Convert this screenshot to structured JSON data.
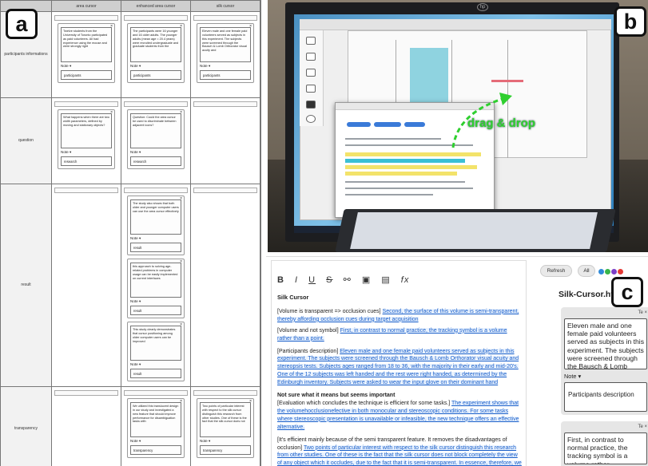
{
  "labels": {
    "a": "a",
    "b": "b",
    "c": "c"
  },
  "panel_a": {
    "columns": [
      "area cursor",
      "enhanced area cursor",
      "silk cursor"
    ],
    "rows": [
      "participants informations",
      "question",
      "result",
      "transparency"
    ],
    "note_label": "Note ▾",
    "close": "×",
    "cards": {
      "r0c0": {
        "text": "Twelve students from the University of Toronto participated as paid volunteers. All had experience using the mouse and were strongly right",
        "note": "participants"
      },
      "r0c1": {
        "text": "The participants were 16 younger and 16 older adults. The younger adults (mean age = 20.4 years) were recruited undergraduate and graduate students from the",
        "note": "participants"
      },
      "r0c2": {
        "text": "Eleven male and one female paid volunteers served as subjects in this experiment. The subjects were screened through the Bausch & Lomb Orthorator visual acuity and",
        "note": "participants"
      },
      "r1c0": {
        "text": "What happens when there are two width parameters, defined by moving and stationary objects?",
        "note": "research"
      },
      "r1c1": {
        "text": "Question: Could the area cursor be used to discriminate between adjacent icons?",
        "note": "research"
      },
      "r2c1a": {
        "text": "The study also shows that both older and younger computer users can use the area cursor effectively",
        "note": "result"
      },
      "r2c1b": {
        "text": "this approach to solving age- related problems in computer usage can be easily implemented on current interfaces",
        "note": "result"
      },
      "r2c1c": {
        "text": "This study clearly demonstrates that cursor positioning among older computer users can be improved",
        "note": "result"
      },
      "r3c1": {
        "text": "We utilized this translucent design in our study and investigated a new feature that should improve performance for disambiguation tasks with",
        "note": "transparency"
      },
      "r3c2": {
        "text": "Two points of particular interest with respect to the silk cursor distinguish this research from other studies. One of these is the fact that the silk cursor does not",
        "note": "transparency"
      }
    }
  },
  "panel_b": {
    "overlay": "drag & drop",
    "logo": "hp"
  },
  "panel_c": {
    "toolbar": {
      "bold": "B",
      "italic": "I",
      "underline": "U",
      "strike": "S",
      "link": "⚯",
      "image": "▣",
      "table": "▤",
      "formula": "fx"
    },
    "doc_title": "Silk Cursor",
    "p1_plain": "[Volume is transparent => occlusion cues] ",
    "p1_link": "Second, the surface of this volume is semi-transparent, thereby affording occlusion cues during target acquisition",
    "p2_plain": "[Volume and not symbol] ",
    "p2_link": "First, in contrast to normal practice, the tracking symbol is a volume rather than a point.",
    "p3_plain": " [Participants description] ",
    "p3_link": "Eleven male and one female paid volunteers served as subjects in this experiment. The subjects were screened through the Bausch & Lomb Orthorator visual acuity and stereopsis tests. Subjects ages ranged from 18 to 36, with the majority in their early and mid-20's. One of the 12 subjects was left handed and the rest were right handed, as determined by the Edinburgh inventory. Subjects were asked to wear the input glove on their dominant hand",
    "p4_bold": "Not sure what it means but seems important",
    "p4_plain": "[Evaluation which concludes the technique is efficient for some tasks.] ",
    "p4_link": "The experiment shows that the volumehocclusionefective in both monocular and stereoscopic conditions. For some tasks where stereoscopic presentation is unavailable or infeasible, the new technique offers an effective alternative.",
    "p5_plain": "[It's efficient mainly because of the semi transparent feature. It removes the disadvantages of occlusion] ",
    "p5_link": "Two points of particular interest with respect to the silk cursor distinguish this research from other studies. One of these is the fact that the silk cursor does not block completely the view of any object which it occludes, due to the fact that it is semi-transparent. In essence, therefore, we contend that not",
    "refresh": "Refresh",
    "all": "All",
    "filename": "Silk-Cursor.html",
    "card_header": "Te ×",
    "card1_text": "Eleven male and one female paid volunteers served as subjects in this experiment. The subjects were screened through the Bausch & Lomb Orthorator visual acuity",
    "note_label": "Note ▾",
    "card1_note": "Participants description",
    "card2_text": "First, in contrast to normal practice, the tracking symbol is a volume rather",
    "dots": [
      "#2f8ad8",
      "#39b54a",
      "#7b3fc7",
      "#e53935"
    ]
  }
}
